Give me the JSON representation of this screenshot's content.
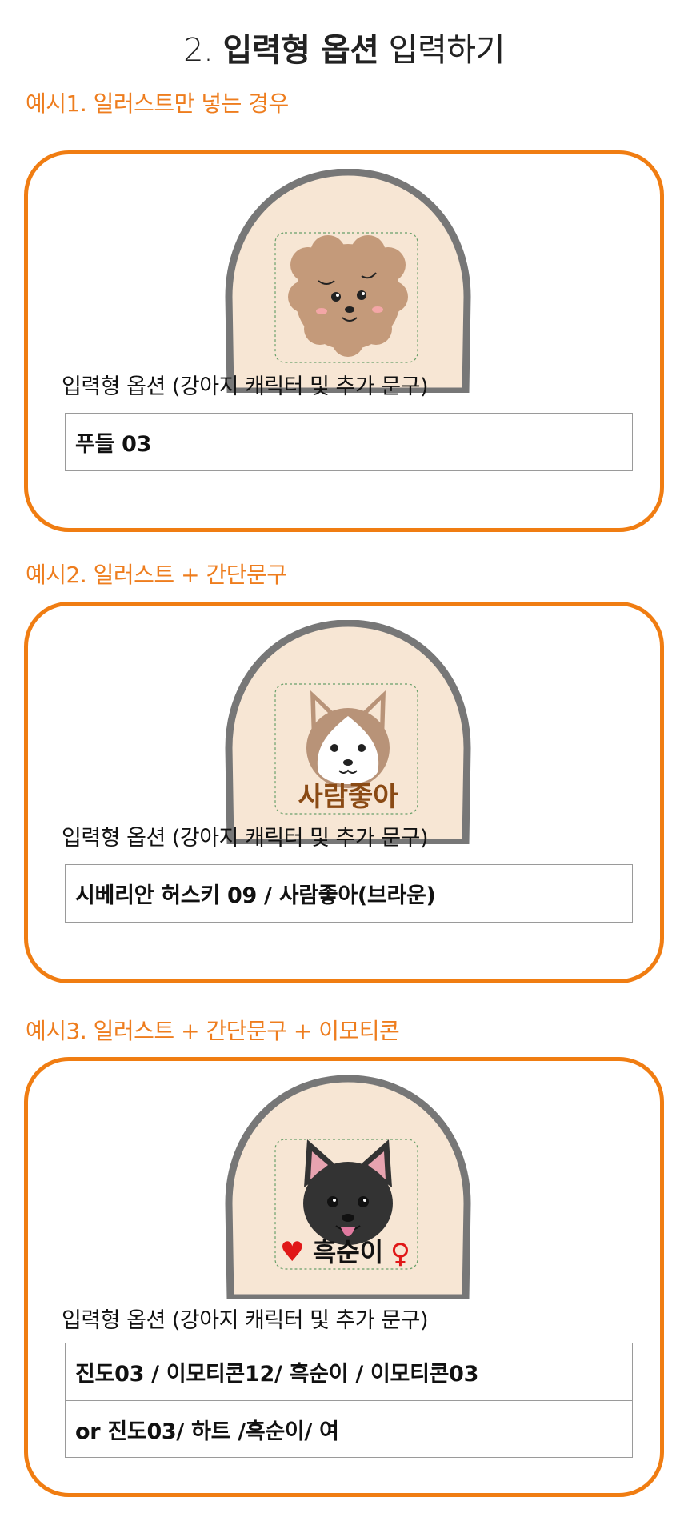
{
  "title": {
    "prefix": "2. ",
    "bold": "입력형 옵션",
    "suffix": " 입력하기"
  },
  "examples": [
    {
      "label": "예시1. 일러스트만 넣는 경우",
      "field_label": "입력형 옵션 (강아지 캐릭터 및 추가 문구)",
      "rows": [
        "푸들 03"
      ]
    },
    {
      "label": "예시2. 일러스트 + 간단문구",
      "field_label": "입력형 옵션 (강아지 캐릭터 및 추가 문구)",
      "figure_text": "사람좋아",
      "rows": [
        "시베리안 허스키 09 / 사람좋아(브라운)"
      ]
    },
    {
      "label": "예시3. 일러스트 + 간단문구 + 이모티콘",
      "field_label": "입력형 옵션 (강아지 캐릭터 및 추가 문구)",
      "figure_text": "흑순이",
      "figure_heart": "♥",
      "figure_female": "♀",
      "rows": [
        "진도03 / 이모티콘12/ 흑순이 / 이모티콘03",
        "or 진도03/  하트  /흑순이/  여"
      ]
    }
  ],
  "colors": {
    "accent": "#f07d12",
    "label_orange": "#ee7d1e",
    "patch_fill": "#f7e6d4",
    "patch_border": "#777777",
    "poodle_brown": "#c49a7a",
    "husky_text": "#8a4a14",
    "heart_red": "#e01818"
  },
  "icons": [
    "poodle-illustration",
    "husky-illustration",
    "jindo-black-illustration",
    "heart-icon",
    "female-symbol-icon"
  ]
}
